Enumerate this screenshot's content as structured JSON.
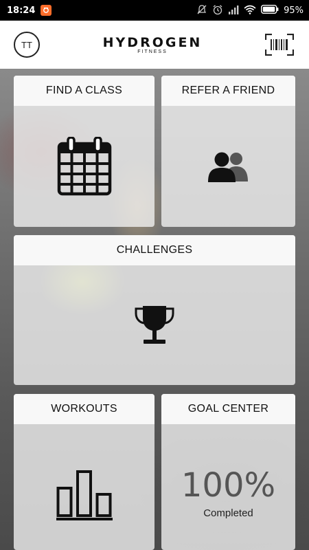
{
  "status_bar": {
    "time": "18:24",
    "battery_percent": "95%",
    "icons": [
      "notification-app-icon",
      "mute-icon",
      "alarm-icon",
      "signal-icon",
      "wifi-icon",
      "battery-icon"
    ]
  },
  "header": {
    "avatar_initials": "TT",
    "brand_name": "HYDROGEN",
    "brand_sub": "FITNESS",
    "barcode_icon": "barcode-scan-icon"
  },
  "tiles": {
    "find_class": {
      "label": "FIND A CLASS",
      "icon": "calendar-icon"
    },
    "refer_friend": {
      "label": "REFER A FRIEND",
      "icon": "people-icon"
    },
    "challenges": {
      "label": "CHALLENGES",
      "icon": "trophy-icon"
    },
    "workouts": {
      "label": "WORKOUTS",
      "icon": "bar-chart-icon"
    },
    "goal_center": {
      "label": "GOAL CENTER",
      "percent": "100%",
      "status": "Completed"
    }
  },
  "colors": {
    "accent": "#ff6d2a",
    "tile_bg": "#f0f0f0",
    "text": "#111111"
  }
}
